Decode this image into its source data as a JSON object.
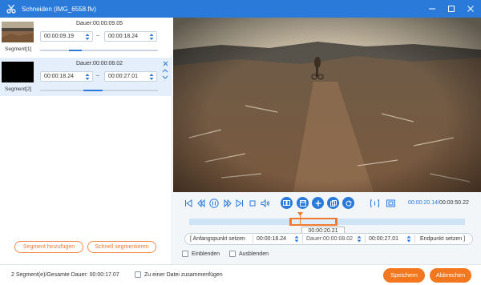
{
  "window": {
    "title": "Schneiden (IMG_6558.flv)",
    "accent_color": "#2a7ad9",
    "app_icon": "scissors-icon"
  },
  "segments": [
    {
      "label": "Segment[1]",
      "duration": "Dauer:00:00:09.05",
      "start": "00:00:09.19",
      "end": "00:00:18.24",
      "progress": 0.36,
      "thumbnail": "landscape-thumbnail"
    },
    {
      "label": "Segment[2]",
      "duration": "Dauer:00:00:08.02",
      "start": "00:00:18.24",
      "end": "00:00:27.01",
      "progress": 0.54,
      "thumbnail": "black-thumbnail"
    }
  ],
  "left_buttons": {
    "add_segment": "Segment hinzufügen",
    "fast_split": "Schnell segmentieren"
  },
  "player": {
    "current_time": "00:00:20.14",
    "separator": "/",
    "total_time": "00:00:50.22",
    "playhead_tooltip": "00:00:20.21",
    "selection_start_fraction": 0.367,
    "selection_end_fraction": 0.538,
    "playhead_fraction": 0.402
  },
  "trim": {
    "set_start": "Anfangspunkt setzen",
    "start_value": "00:00:18.24",
    "duration_value": "Dauer:00:00:08.02",
    "end_value": "00:00:27.01",
    "set_end": "Endpunkt setzen"
  },
  "options": {
    "fade_in": "Einblenden",
    "fade_out": "Ausblenden"
  },
  "footer": {
    "status": "2 Segment(e)/Gesamte Dauer: 00:00:17.07",
    "merge_label": "Zu einer Datei zusammenfügen",
    "save": "Speichern",
    "cancel": "Abbrechen",
    "button_color": "#f2771f"
  }
}
